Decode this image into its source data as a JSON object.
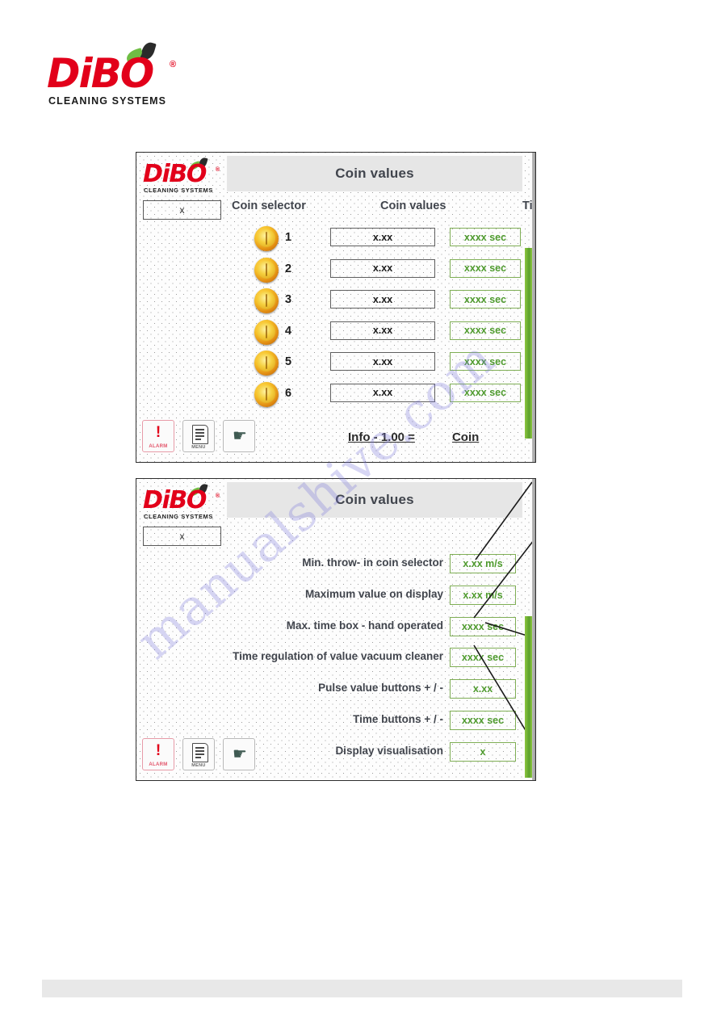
{
  "page": {
    "brand": {
      "name": "DiBO",
      "tagline": "CLEANING SYSTEMS",
      "registered": "®"
    },
    "watermark": "manualshive.com"
  },
  "panel1": {
    "title": "Coin values",
    "selector_box_value": "x",
    "columns": {
      "selector": "Coin selector",
      "values": "Coin values",
      "time": "Time"
    },
    "rows": [
      {
        "index": "1",
        "value": "x.xx",
        "time": "xxxx sec"
      },
      {
        "index": "2",
        "value": "x.xx",
        "time": "xxxx sec"
      },
      {
        "index": "3",
        "value": "x.xx",
        "time": "xxxx sec"
      },
      {
        "index": "4",
        "value": "x.xx",
        "time": "xxxx sec"
      },
      {
        "index": "5",
        "value": "x.xx",
        "time": "xxxx sec"
      },
      {
        "index": "6",
        "value": "x.xx",
        "time": "xxxx sec"
      }
    ],
    "toolbar": {
      "alarm_label": "ALARM",
      "alarm_mark": "!",
      "menu_label": "MENU",
      "hand_glyph": "☛"
    },
    "info": {
      "left": "Info - 1.00 =",
      "right": "Coin"
    }
  },
  "panel2": {
    "title": "Coin values",
    "selector_box_value": "x",
    "rows": [
      {
        "label": "Min. throw- in coin selector",
        "value": "x.xx m/s"
      },
      {
        "label": "Maximum value on display",
        "value": "x.xx m/s"
      },
      {
        "label": "Max. time box - hand operated",
        "value": "xxxx sec"
      },
      {
        "label": "Time regulation of value vacuum cleaner",
        "value": "xxxx sec"
      },
      {
        "label": "Pulse value buttons  + / -",
        "value": "x.xx"
      },
      {
        "label": "Time   buttons  + / -",
        "value": "xxxx sec"
      },
      {
        "label": "Display visualisation",
        "value": "x"
      }
    ],
    "toolbar": {
      "alarm_label": "ALARM",
      "alarm_mark": "!",
      "menu_label": "MENU",
      "hand_glyph": "☛"
    }
  },
  "colors": {
    "brand_red": "#e2001a",
    "leaf_green": "#6fbe44",
    "value_green": "#4f9b2e",
    "title_grey": "#41454d",
    "edge_green": "#8dc63f"
  }
}
